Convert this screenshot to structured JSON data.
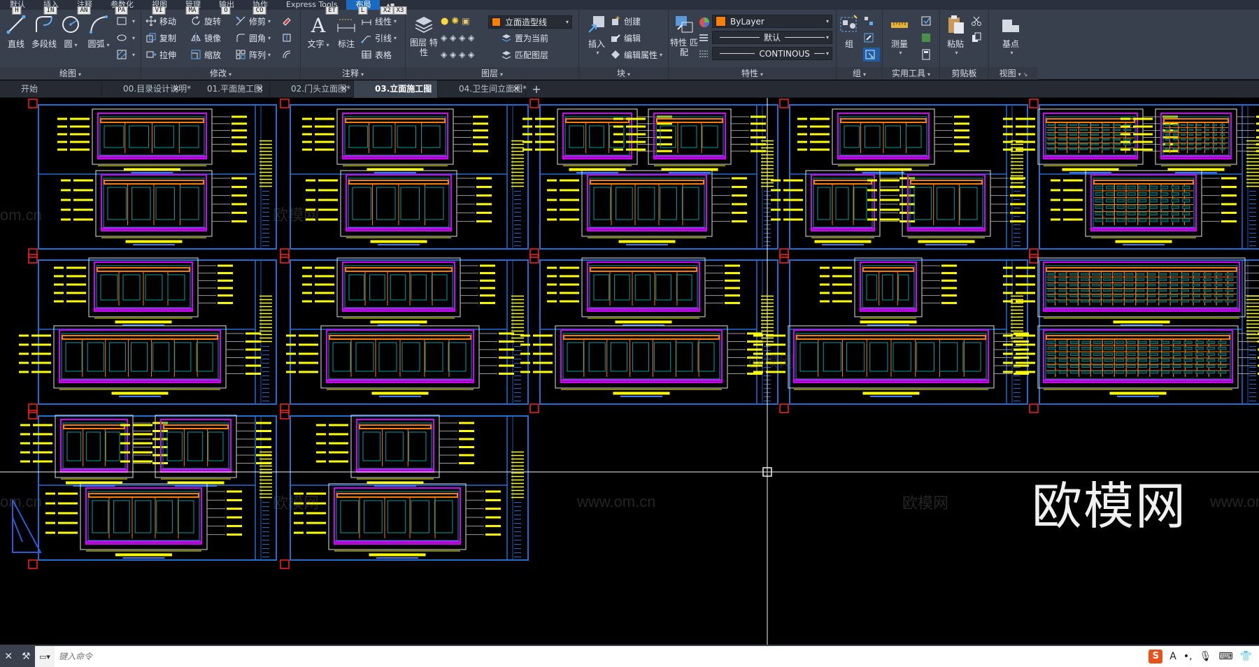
{
  "ribbon_tabs": [
    {
      "label": "默认",
      "key": "H"
    },
    {
      "label": "插入",
      "key": "IN"
    },
    {
      "label": "注释",
      "key": "AN"
    },
    {
      "label": "参数化",
      "key": "PA"
    },
    {
      "label": "视图",
      "key": "VI"
    },
    {
      "label": "管理",
      "key": "MA"
    },
    {
      "label": "输出",
      "key": "O"
    },
    {
      "label": "协作",
      "key": "CO"
    },
    {
      "label": "Express Tools",
      "key": "ET"
    },
    {
      "label": "布局",
      "key": "L"
    }
  ],
  "extra_keytips": [
    "X2",
    "X3"
  ],
  "draw": {
    "title": "绘图",
    "line": "直线",
    "polyline": "多段线",
    "circle": "圆",
    "arc": "圆弧"
  },
  "modify": {
    "title": "修改",
    "move": "移动",
    "rotate": "旋转",
    "trim": "修剪",
    "copy": "复制",
    "mirror": "镜像",
    "fillet": "圆角",
    "stretch": "拉伸",
    "scale": "缩放",
    "array": "阵列"
  },
  "annotation": {
    "title": "注释",
    "text": "文字",
    "dimension": "标注",
    "linear": "线性",
    "leader": "引线",
    "table": "表格"
  },
  "layers": {
    "title": "图层",
    "properties": "图层\n特性",
    "current_layer": "立面造型线",
    "current_layer_color": "#ff7f00",
    "set_current": "置为当前",
    "match_layer": "匹配图层"
  },
  "block": {
    "title": "块",
    "insert": "插入",
    "create": "创建",
    "edit": "编辑",
    "edit_attributes": "编辑属性"
  },
  "properties": {
    "title": "特性",
    "match": "特性\n匹配",
    "color_value": "ByLayer",
    "color_swatch": "#ff7f00",
    "lineweight_value": "默认",
    "linetype_value": "CONTINOUS"
  },
  "groups": {
    "title": "组",
    "group": "组"
  },
  "utilities": {
    "title": "实用工具",
    "measure": "测量"
  },
  "clipboard": {
    "title": "剪贴板",
    "paste": "粘贴"
  },
  "view": {
    "title": "视图",
    "base": "基点"
  },
  "file_tabs": [
    {
      "label": "开始",
      "active": false,
      "closable": false
    },
    {
      "label": "00.目录设计说明*",
      "active": false,
      "closable": true
    },
    {
      "label": "01.平面施工图",
      "active": false,
      "closable": true
    },
    {
      "label": "02.门头立面图*",
      "active": false,
      "closable": true
    },
    {
      "label": "03.立面施工图",
      "active": true,
      "closable": true
    },
    {
      "label": "04.卫生间立面图*",
      "active": false,
      "closable": true
    }
  ],
  "watermarks": {
    "site": "www.om.cn",
    "site_short": "om.cn",
    "brand": "欧模网",
    "brand_big": "欧模网"
  },
  "command_line": {
    "placeholder": "键入命令"
  },
  "tray": {
    "ime": "S",
    "lang": "A"
  },
  "colors": {
    "frame_blue": "#1f6fd6",
    "magenta": "#d200ff",
    "orange": "#ff7a00",
    "yellow": "#ffff00",
    "red": "#ff2020",
    "teal": "#00a0a0"
  }
}
